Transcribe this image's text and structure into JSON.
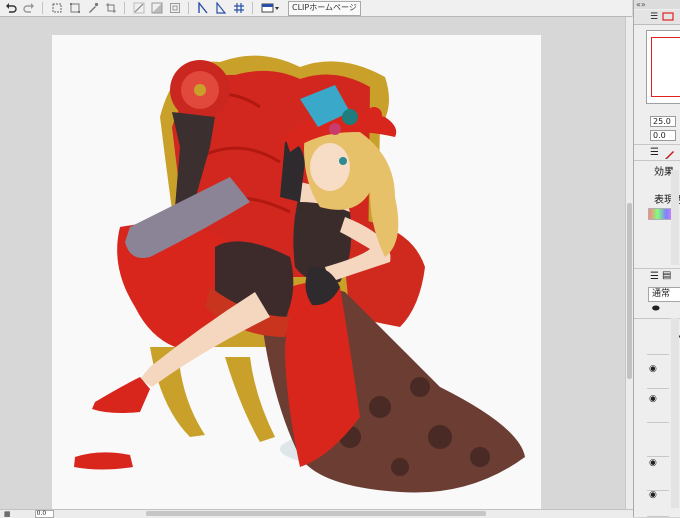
{
  "toolbar": {
    "homepage_button": "CLIPホームページ"
  },
  "panel": {
    "brush_size": "25.0",
    "brush_opacity": "0.0",
    "effect_label": "効果",
    "expression_color_label": "表現色",
    "blend_mode": "通常"
  },
  "statusbar": {
    "zoom_value": "0.0"
  },
  "icons": [
    "undo-icon",
    "redo-icon",
    "select-all-icon",
    "transform-icon",
    "eyedropper-icon",
    "crop-icon",
    "ruler-icon",
    "fill-icon",
    "frame-icon",
    "snap-icon",
    "grid-icon",
    "layer-menu-icon",
    "eye-icon",
    "pen-icon",
    "collapse-icon"
  ],
  "colors": {
    "accent_red": "#e02020",
    "canvas_bg": "#d7d7d7",
    "paper": "#f9f9f9"
  }
}
